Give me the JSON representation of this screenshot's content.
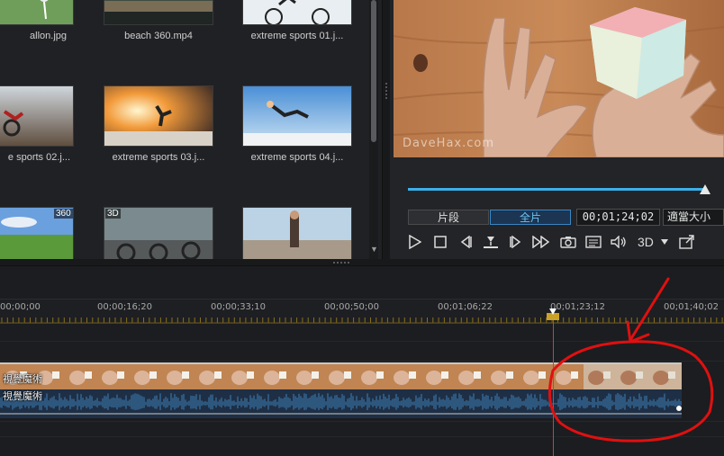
{
  "library": {
    "items": [
      {
        "name": "balloon",
        "label": "allon.jpg",
        "badge": ""
      },
      {
        "name": "beach",
        "label": "beach 360.mp4",
        "badge": ""
      },
      {
        "name": "sports01",
        "label": "extreme sports 01.j...",
        "badge": ""
      },
      {
        "name": "sports02",
        "label": "e sports 02.j...",
        "badge": ""
      },
      {
        "name": "sports03",
        "label": "extreme sports 03.j...",
        "badge": ""
      },
      {
        "name": "sports04",
        "label": "extreme sports 04.j...",
        "badge": ""
      },
      {
        "name": "landscape360",
        "label": "",
        "badge": "360"
      },
      {
        "name": "motorcycles3d",
        "label": "",
        "badge": "3D"
      },
      {
        "name": "skater",
        "label": "",
        "badge": ""
      }
    ]
  },
  "preview": {
    "watermark": "DaveHax.com",
    "progress_fraction": 0.985,
    "clip_mode_label": "片段",
    "movie_mode_label": "全片",
    "active_mode": "movie",
    "timecode": "00;01;24;02",
    "quality_label": "適當大小",
    "threeD_label": "3D"
  },
  "timeline": {
    "ruler_labels": [
      "00;00;00",
      "00;00;16;20",
      "00;00;33;10",
      "00;00;50;00",
      "00;01;06;22",
      "00;01;23;12",
      "00;01;40;02"
    ],
    "video_clip_title": "視覺魔術",
    "audio_clip_title": "視覺魔術",
    "playhead_time": "00;01;24;02"
  },
  "colors": {
    "accent": "#3bb0e8",
    "playhead": "#d83a3a",
    "annotation": "#e01010",
    "audio_wave": "#3f7fb8"
  },
  "icons": [
    "play-icon",
    "stop-icon",
    "previous-frame-icon",
    "split-icon",
    "next-frame-icon",
    "fast-forward-icon",
    "snapshot-camera-icon",
    "subtitle-icon",
    "volume-icon",
    "dropdown-arrow-icon",
    "undock-window-icon"
  ]
}
